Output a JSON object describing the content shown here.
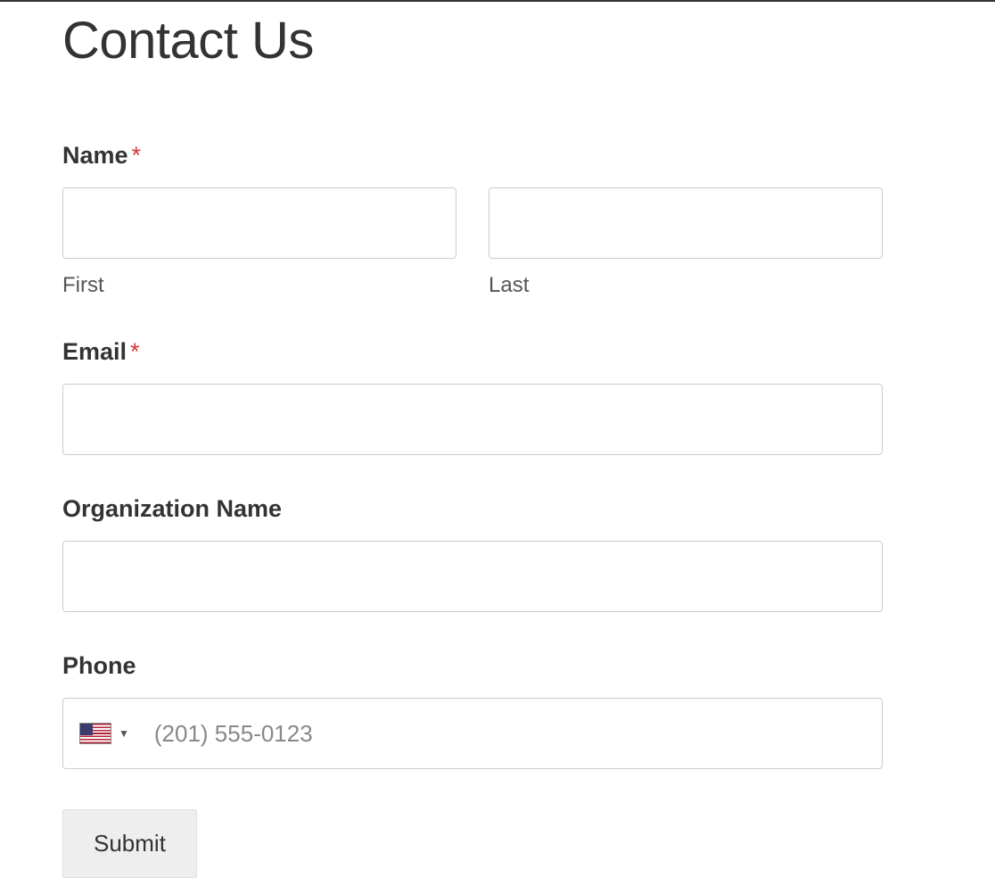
{
  "page": {
    "title": "Contact Us"
  },
  "form": {
    "name": {
      "label": "Name",
      "required": "*",
      "first": {
        "value": "",
        "sublabel": "First"
      },
      "last": {
        "value": "",
        "sublabel": "Last"
      }
    },
    "email": {
      "label": "Email",
      "required": "*",
      "value": ""
    },
    "organization": {
      "label": "Organization Name",
      "value": ""
    },
    "phone": {
      "label": "Phone",
      "country_icon": "us-flag",
      "placeholder": "(201) 555-0123",
      "value": ""
    },
    "submit": {
      "label": "Submit"
    }
  }
}
